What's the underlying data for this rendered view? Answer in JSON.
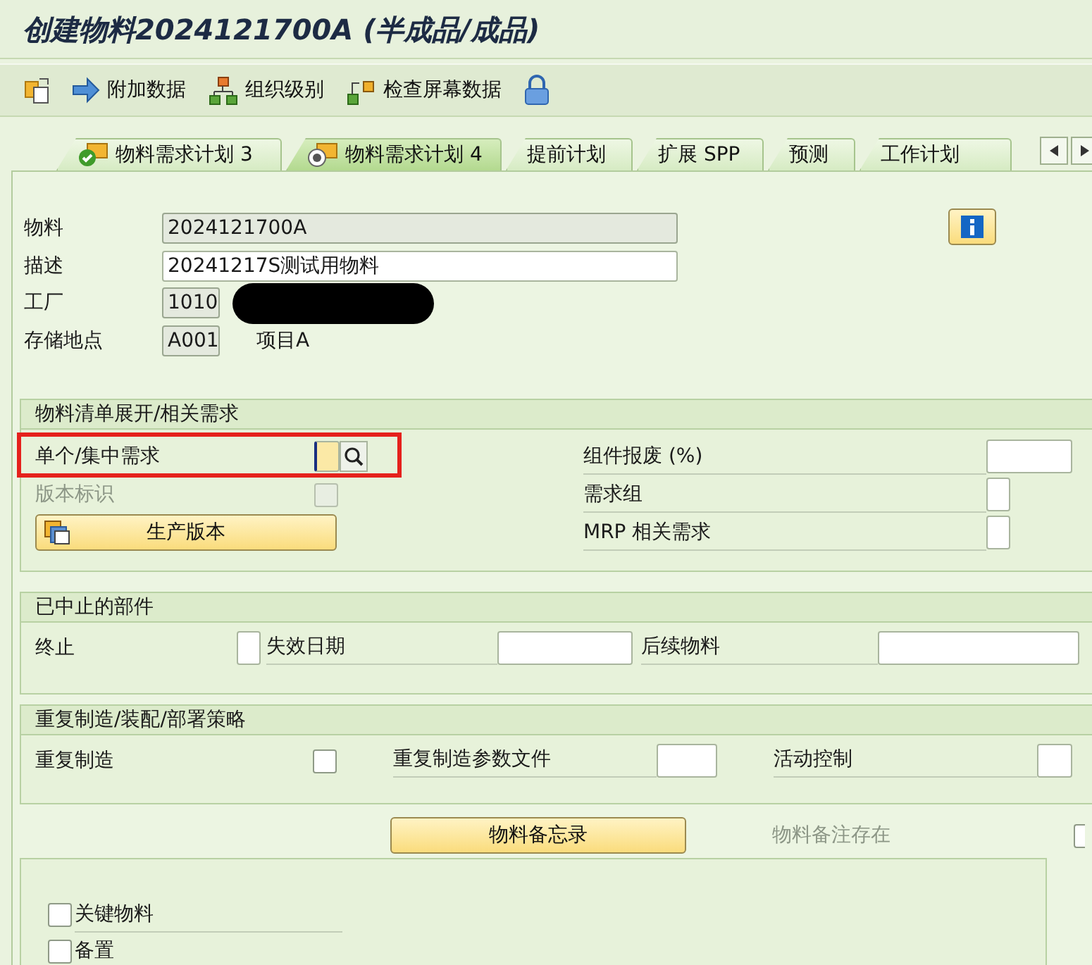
{
  "title": "创建物料2024121700A (半成品/成品)",
  "toolbar": [
    {
      "label": "附加数据"
    },
    {
      "label": "组织级别"
    },
    {
      "label": "检查屏幕数据"
    }
  ],
  "tabs": [
    {
      "label": "物料需求计划 3",
      "selected": false,
      "kind": "done"
    },
    {
      "label": "物料需求计划 4",
      "selected": true,
      "kind": "current"
    },
    {
      "label": "提前计划",
      "selected": false,
      "kind": "plain"
    },
    {
      "label": "扩展 SPP",
      "selected": false,
      "kind": "plain"
    },
    {
      "label": "预测",
      "selected": false,
      "kind": "plain"
    },
    {
      "label": "工作计划",
      "selected": false,
      "kind": "plain"
    }
  ],
  "header_fields": [
    {
      "label": "物料",
      "value": "2024121700A",
      "editable": false
    },
    {
      "label": "描述",
      "value": "20241217S测试用物料",
      "editable": true
    },
    {
      "label": "工厂",
      "value": "1010",
      "editable": false,
      "redacted": true
    },
    {
      "label": "存储地点",
      "value": "A001",
      "editable": false,
      "note": "项目A"
    }
  ],
  "bom_section": {
    "title": "物料清单展开/相关需求",
    "individual_collective": {
      "label": "单个/集中需求",
      "focused": true,
      "highlighted": true
    },
    "version_indicator": {
      "label": "版本标识",
      "checked": false,
      "disabled": true
    },
    "production_version_button": "生产版本",
    "component_scrap": {
      "label": "组件报废 (%)"
    },
    "requirements_group": {
      "label": "需求组"
    },
    "mrp_dependent_requirements": {
      "label": "MRP 相关需求"
    }
  },
  "discontinued_section": {
    "title": "已中止的部件",
    "discontinuation": {
      "label": "终止"
    },
    "effective_out_date": {
      "label": "失效日期"
    },
    "follow_up_material": {
      "label": "后续物料"
    }
  },
  "repetitive_section": {
    "title": "重复制造/装配/部署策略",
    "repetitive_mfg": {
      "label": "重复制造",
      "checked": false
    },
    "rem_profile": {
      "label": "重复制造参数文件"
    },
    "action_control": {
      "label": "活动控制"
    }
  },
  "notes": {
    "button": "物料备忘录",
    "status": "物料备注存在",
    "checked": false
  },
  "bottom_box": {
    "checkboxes": [
      {
        "label": "关键物料",
        "checked": false
      },
      {
        "label": "备置",
        "checked": false
      }
    ]
  }
}
